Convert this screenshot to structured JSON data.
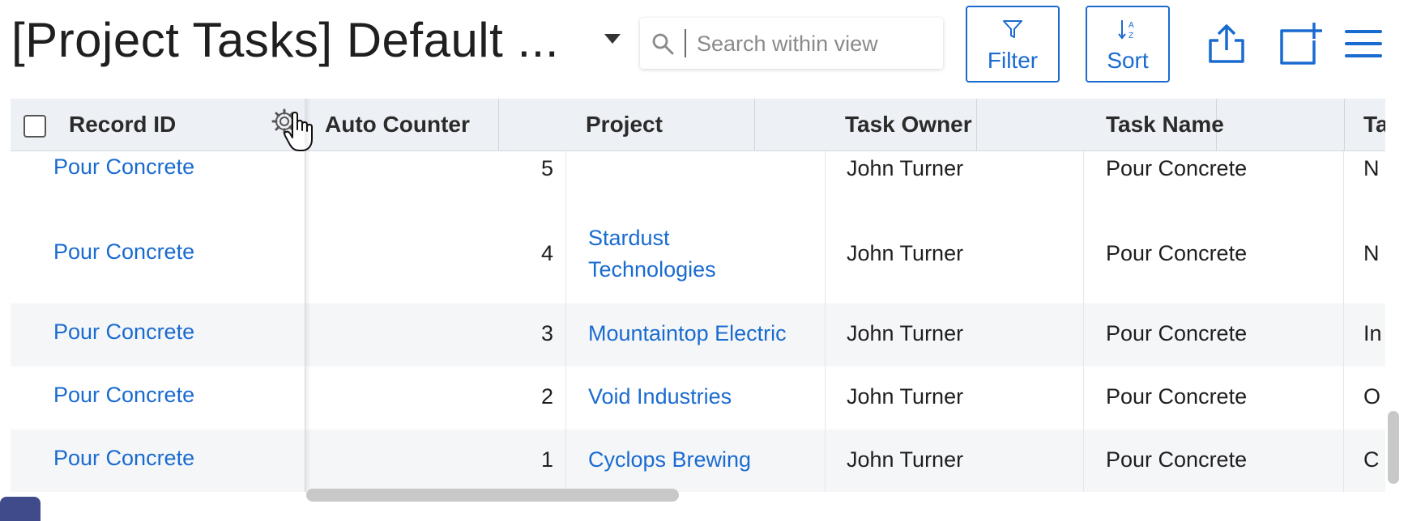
{
  "view": {
    "title": "[Project Tasks] Default ...",
    "search_placeholder": "Search within view"
  },
  "toolbar": {
    "filter_label": "Filter",
    "sort_label": "Sort",
    "accent_color": "#1a6bd0"
  },
  "grid": {
    "columns": [
      "Record ID",
      "Auto Counter",
      "Project",
      "Task Owner",
      "Task Name",
      "Ta"
    ],
    "rows": [
      {
        "record_id": "Pour Concrete",
        "auto_counter": "5",
        "project": "",
        "task_owner": "John Turner",
        "task_name": "Pour Concrete",
        "truncated": "N"
      },
      {
        "record_id": "Pour Concrete",
        "auto_counter": "4",
        "project_line1": "Stardust",
        "project_line2": "Technologies",
        "task_owner": "John Turner",
        "task_name": "Pour Concrete",
        "truncated": "N"
      },
      {
        "record_id": "Pour Concrete",
        "auto_counter": "3",
        "project": "Mountaintop Electric",
        "task_owner": "John Turner",
        "task_name": "Pour Concrete",
        "truncated": "In"
      },
      {
        "record_id": "Pour Concrete",
        "auto_counter": "2",
        "project": "Void Industries",
        "task_owner": "John Turner",
        "task_name": "Pour Concrete",
        "truncated": "O"
      },
      {
        "record_id": "Pour Concrete",
        "auto_counter": "1",
        "project": "Cyclops Brewing",
        "task_owner": "John Turner",
        "task_name": "Pour Concrete",
        "truncated": "C"
      }
    ]
  },
  "icons": {
    "search": "search-icon",
    "dropdown": "chevron-down-icon",
    "filter": "funnel-icon",
    "sort": "sort-az-icon",
    "export": "export-icon",
    "add": "add-record-icon",
    "menu": "hamburger-menu-icon",
    "gear": "gear-icon",
    "cursor": "hand-cursor-icon"
  }
}
